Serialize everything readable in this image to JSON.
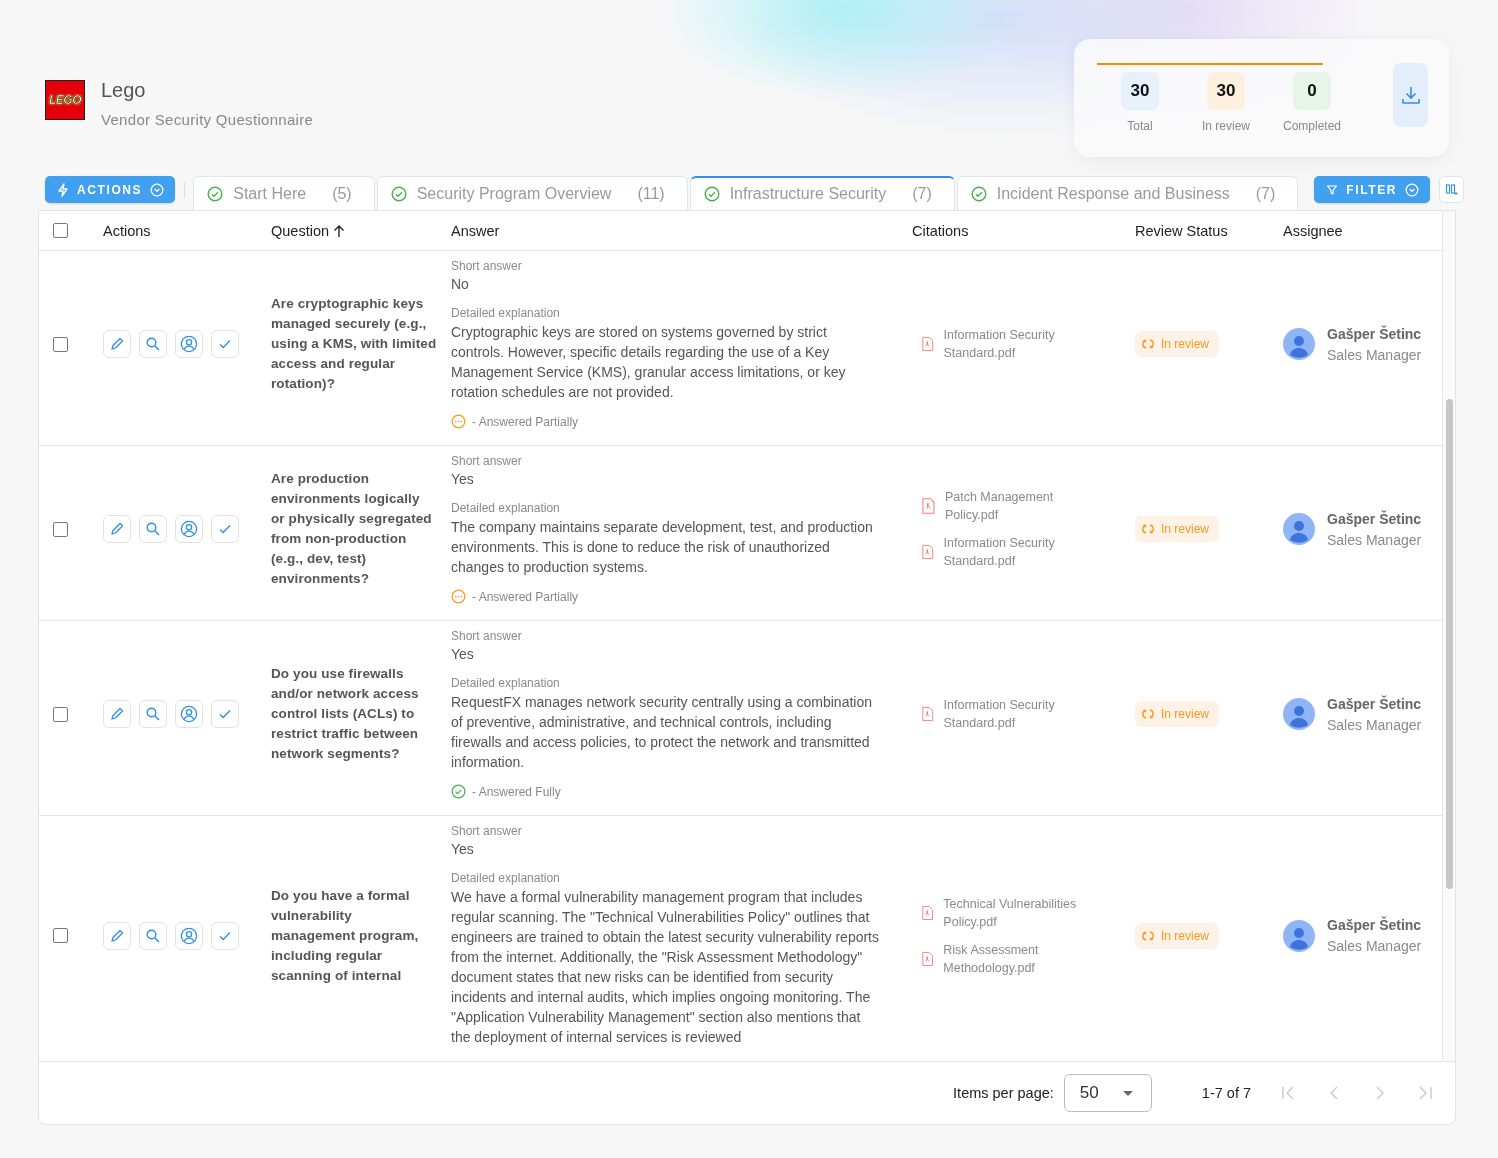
{
  "company": {
    "logo_text": "LEGO",
    "name": "Lego",
    "subtitle": "Vendor Security Questionnaire"
  },
  "review_progress": {
    "level": 1
  },
  "stats": [
    {
      "value": "30",
      "label": "Total",
      "color": "#e6f1fc"
    },
    {
      "value": "30",
      "label": "In review",
      "color": "#fdf0df"
    },
    {
      "value": "0",
      "label": "Completed",
      "color": "#e7f4e8"
    }
  ],
  "actions_button": "ACTIONS",
  "tabs": [
    {
      "label": "Start Here",
      "count": "(5)",
      "selected": false,
      "done": true
    },
    {
      "label": "Security Program Overview",
      "count": "(11)",
      "selected": false,
      "done": true
    },
    {
      "label": "Infrastructure Security",
      "count": "(7)",
      "selected": true,
      "done": true
    },
    {
      "label": "Incident Response and Business",
      "count": "(7)",
      "selected": false,
      "done": true
    }
  ],
  "filter_button": "FILTER",
  "table": {
    "all_checked": false,
    "columns": [
      {
        "label": "Actions",
        "sorted": false
      },
      {
        "label": "Question",
        "sorted": true
      },
      {
        "label": "Answer",
        "sorted": false
      },
      {
        "label": "Citations",
        "sorted": false
      },
      {
        "label": "Review Status",
        "sorted": false
      },
      {
        "label": "Assignee",
        "sorted": false
      }
    ],
    "rows": [
      {
        "checked": false,
        "question": "Are cryptographic keys managed securely (e.g., using a KMS, with limited access and regular rotation)?",
        "short_label": "Short answer",
        "short_answer": "No",
        "detail_label": "Detailed explanation",
        "detail": "Cryptographic keys are stored on systems governed by strict controls. However, specific details regarding the use of a Key Management Service (KMS), granular access limitations, or key rotation schedules are not provided.",
        "completeness": {
          "kind": "partial",
          "label": "- Answered Partially"
        },
        "citations": [
          "Information Security Standard.pdf"
        ],
        "status": "In review",
        "assignee": {
          "name": "Gašper Šetinc",
          "role": "Sales Manager"
        }
      },
      {
        "checked": false,
        "question": "Are production environments logically or physically segregated from non-production (e.g., dev, test) environments?",
        "short_label": "Short answer",
        "short_answer": "Yes",
        "detail_label": "Detailed explanation",
        "detail": "The company maintains separate development, test, and production environments. This is done to reduce the risk of unauthorized changes to production systems.",
        "completeness": {
          "kind": "partial",
          "label": "- Answered Partially"
        },
        "citations": [
          "Patch Management Policy.pdf",
          "Information Security Standard.pdf"
        ],
        "status": "In review",
        "assignee": {
          "name": "Gašper Šetinc",
          "role": "Sales Manager"
        }
      },
      {
        "checked": false,
        "question": "Do you use firewalls and/or network access control lists (ACLs) to restrict traffic between network segments?",
        "short_label": "Short answer",
        "short_answer": "Yes",
        "detail_label": "Detailed explanation",
        "detail": "RequestFX manages network security centrally using a combination of preventive, administrative, and technical controls, including firewalls and access policies, to protect the network and transmitted information.",
        "completeness": {
          "kind": "full",
          "label": "- Answered Fully"
        },
        "citations": [
          "Information Security Standard.pdf"
        ],
        "status": "In review",
        "assignee": {
          "name": "Gašper Šetinc",
          "role": "Sales Manager"
        }
      },
      {
        "checked": false,
        "question": "Do you have a formal vulnerability management program, including regular scanning of internal",
        "short_label": "Short answer",
        "short_answer": "Yes",
        "detail_label": "Detailed explanation",
        "detail": "We have a formal vulnerability management program that includes regular scanning. The \"Technical Vulnerabilities Policy\" outlines that engineers are trained to obtain the latest security vulnerability reports from the internet. Additionally, the \"Risk Assessment Methodology\" document states that new risks can be identified from security incidents and internal audits, which implies ongoing monitoring. The \"Application Vulnerability Management\" section also mentions that the deployment of internal services is reviewed",
        "citations": [
          "Technical Vulnerabilities Policy.pdf",
          "Risk Assessment Methodology.pdf"
        ],
        "status": "In review",
        "assignee": {
          "name": "Gašper Šetinc",
          "role": "Sales Manager"
        }
      }
    ]
  },
  "pagination": {
    "label": "Items per page:",
    "page_size": "50",
    "range": "1-7 of 7"
  }
}
